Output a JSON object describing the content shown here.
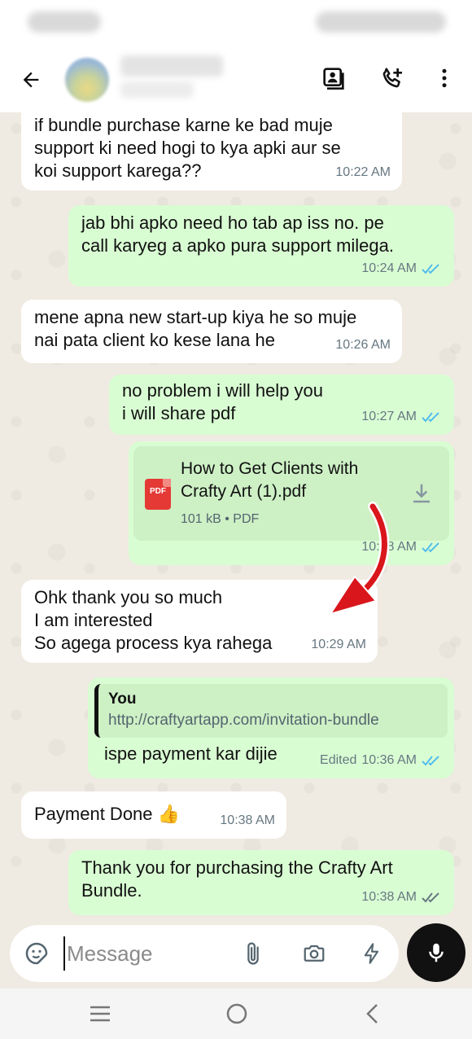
{
  "status_bar": {
    "left_text": "",
    "right_text": ""
  },
  "header": {
    "contact_name": "",
    "contact_status": "",
    "icons": [
      "back-arrow-icon",
      "contacts-book-icon",
      "add-call-icon",
      "more-vert-icon"
    ]
  },
  "messages": [
    {
      "dir": "in",
      "text": "if bundle purchase karne ke bad muje\nsupport ki need hogi to kya apki aur se\nkoi support karega??",
      "time": "10:22 AM"
    },
    {
      "dir": "out",
      "text": "jab bhi apko need ho tab ap iss no. pe\ncall karyeg a apko pura support milega.",
      "time": "10:24 AM"
    },
    {
      "dir": "in",
      "text": "mene apna new start-up kiya he so muje\nnai pata client ko kese lana he",
      "time": "10:26 AM"
    },
    {
      "dir": "out",
      "text": "no problem i will help you\ni will share pdf",
      "time": "10:27 AM"
    },
    {
      "dir": "out",
      "type": "document",
      "file_name": "How to Get Clients with\nCrafty Art (1).pdf",
      "file_icon": "PDF",
      "file_info": "101 kB • PDF",
      "time": "10:28 AM"
    },
    {
      "dir": "in",
      "text": "Ohk thank you so much\nI am interested\nSo agega process kya rahega",
      "time": "10:29 AM"
    },
    {
      "dir": "out",
      "type": "reply",
      "quote_author": "You",
      "quote_text": "http://craftyartapp.com/invitation-bundle",
      "text": "ispe payment kar dijie",
      "edited_label": "Edited",
      "time": "10:36 AM"
    },
    {
      "dir": "in",
      "text": "Payment Done 👍",
      "time": "10:38 AM"
    },
    {
      "dir": "out",
      "text": "Thank you for purchasing the Crafty Art\nBundle.",
      "time": "10:38 AM",
      "ticks": "delivered"
    }
  ],
  "composer": {
    "placeholder": "Message"
  },
  "colors": {
    "tick_read": "#53bdeb",
    "tick_delivered": "#667781",
    "arrow_annotation": "#d9161c"
  }
}
